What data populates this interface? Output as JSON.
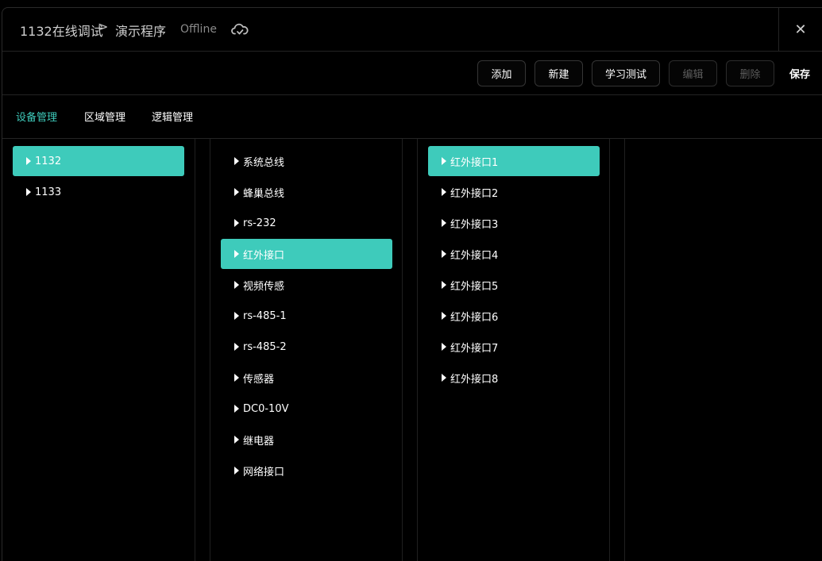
{
  "title": {
    "device": "1132在线调试",
    "separator": ">",
    "program": "演示程序",
    "status": "Offline",
    "status_icon": "cloud-sync-icon",
    "close": "✕"
  },
  "toolbar": {
    "add": "添加",
    "new": "新建",
    "learn_test": "学习测试",
    "edit": "编辑",
    "delete": "删除",
    "save": "保存"
  },
  "tabs": [
    "设备管理",
    "区域管理",
    "逻辑管理"
  ],
  "active_tab": 0,
  "colors": {
    "accent": "#3ecbbb",
    "background": "#000000",
    "disabled_text": "#5c5c5c"
  },
  "columns": {
    "devices": {
      "items": [
        "1132",
        "1133"
      ],
      "selected": 0
    },
    "buses": {
      "items": [
        "系统总线",
        "蜂巢总线",
        "rs-232",
        "红外接口",
        "视频传感",
        "rs-485-1",
        "rs-485-2",
        "传感器",
        "DC0-10V",
        "继电器",
        "网络接口"
      ],
      "selected": 3
    },
    "ports": {
      "items": [
        "红外接口1",
        "红外接口2",
        "红外接口3",
        "红外接口4",
        "红外接口5",
        "红外接口6",
        "红外接口7",
        "红外接口8"
      ],
      "selected": 0
    }
  }
}
